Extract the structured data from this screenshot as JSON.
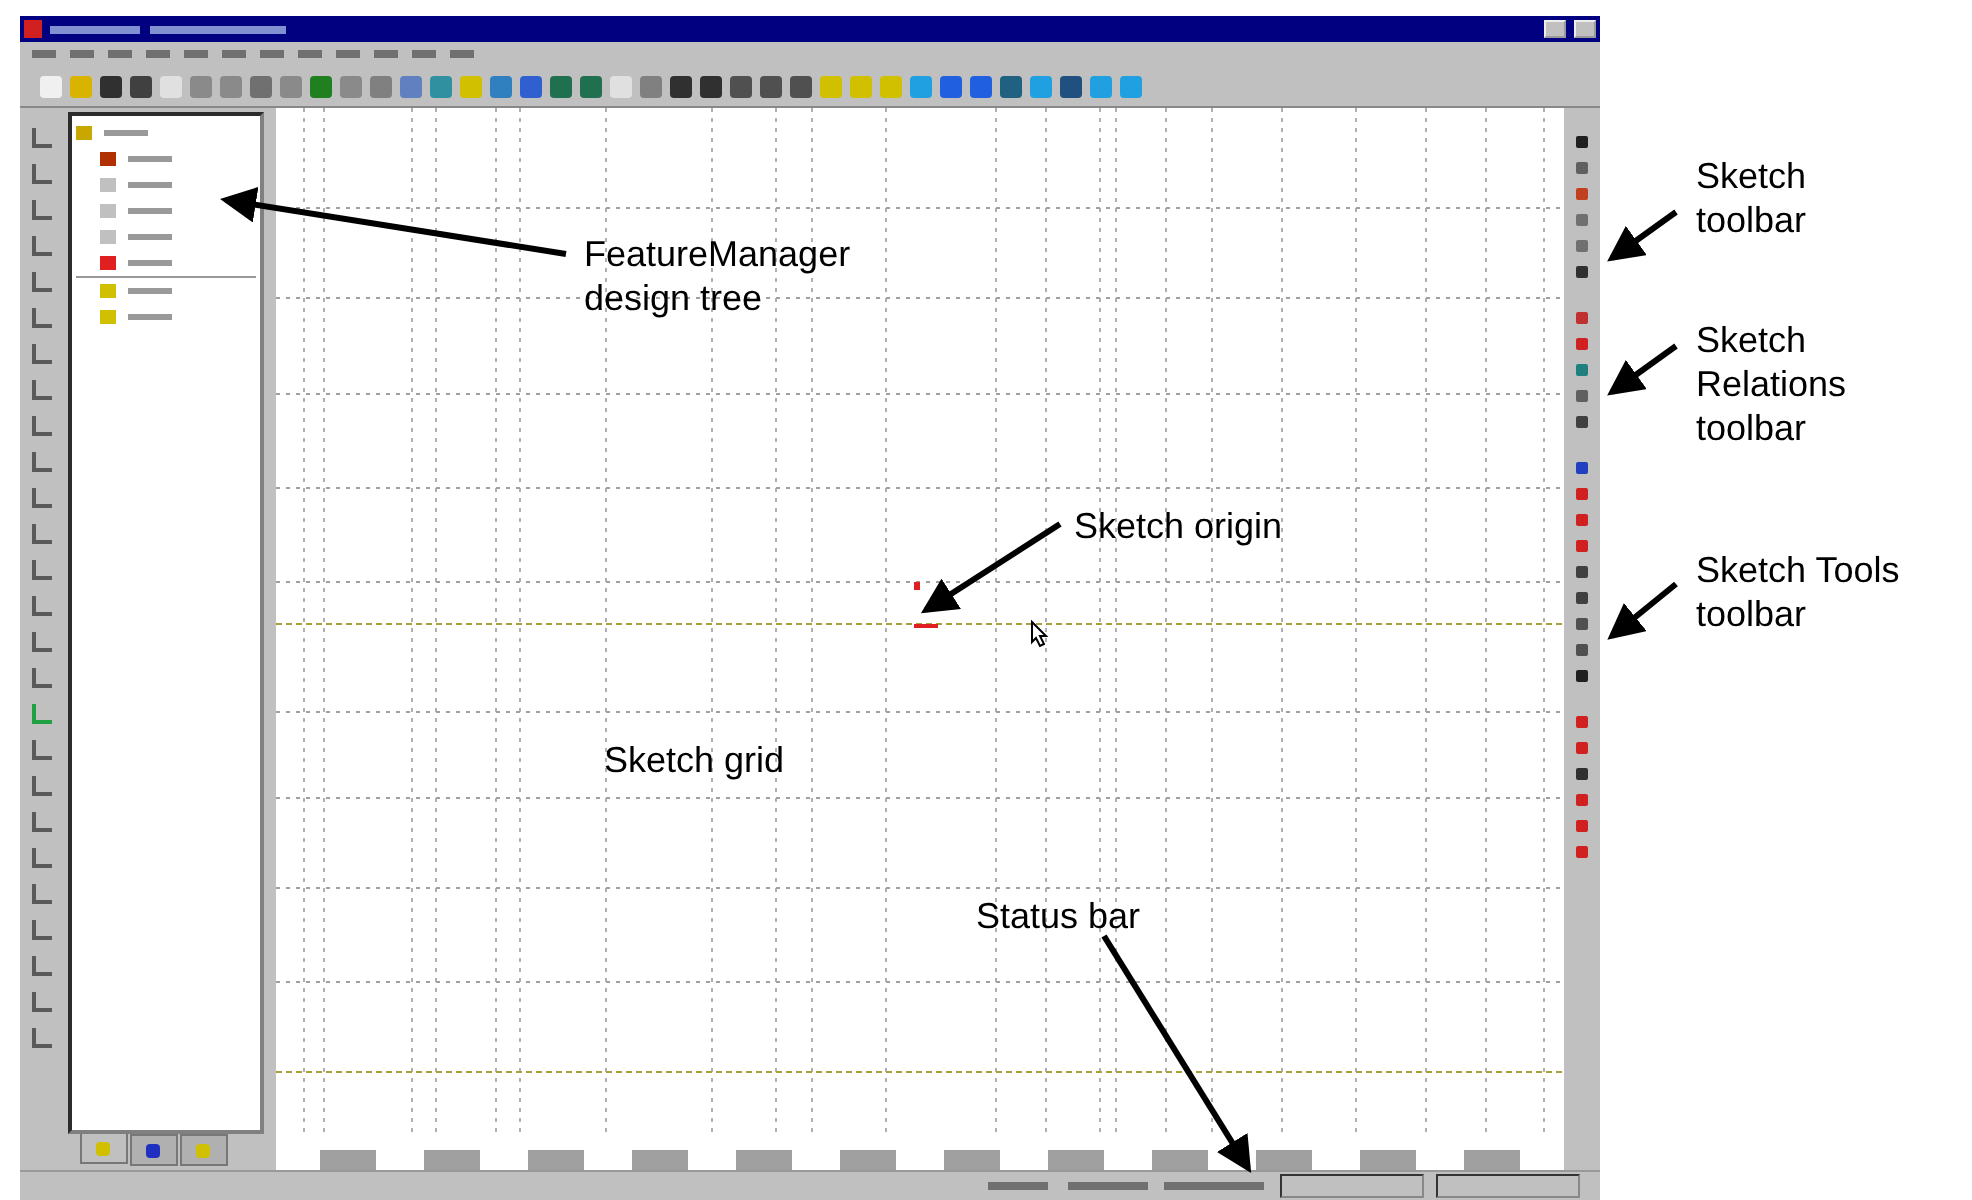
{
  "annotations": [
    {
      "label": "FeatureManager design tree"
    },
    {
      "label": "Sketch toolbar"
    },
    {
      "label": "Sketch Relations toolbar"
    },
    {
      "label": "Sketch origin"
    },
    {
      "label": "Sketch Tools toolbar"
    },
    {
      "label": "Sketch grid"
    },
    {
      "label": "Status bar"
    }
  ]
}
